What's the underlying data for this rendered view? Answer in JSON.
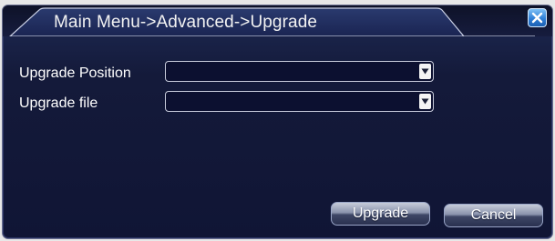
{
  "window": {
    "title": "Main Menu->Advanced->Upgrade",
    "close_icon": "close-icon"
  },
  "form": {
    "upgrade_position": {
      "label": "Upgrade Position",
      "value": ""
    },
    "upgrade_file": {
      "label": "Upgrade file",
      "value": ""
    }
  },
  "buttons": {
    "upgrade_label": "Upgrade",
    "cancel_label": "Cancel"
  },
  "colors": {
    "panel_background": "#141a3a",
    "close_button": "#2f7fd6"
  }
}
